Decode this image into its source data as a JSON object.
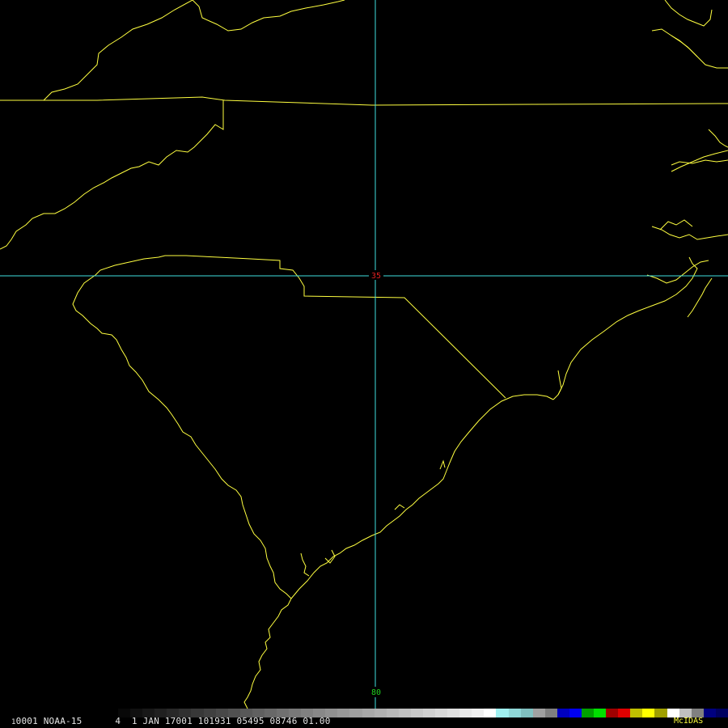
{
  "map": {
    "latitude_label": "35",
    "longitude_label": "80",
    "colors": {
      "background": "#000000",
      "coastline": "#ffff40",
      "gridline": "#40e0e0",
      "latitude_label": "#e02020",
      "longitude_label": "#20d020"
    }
  },
  "status_bar": {
    "frame": "1",
    "line": "0001 NOAA-15      4  1 JAN 17001 101931 05495 08746 01.00",
    "brand": "McIDAS"
  },
  "colorbar": [
    "#080808",
    "#101010",
    "#181818",
    "#202020",
    "#282828",
    "#303030",
    "#383838",
    "#404040",
    "#484848",
    "#505050",
    "#585858",
    "#606060",
    "#686868",
    "#707070",
    "#787878",
    "#808080",
    "#888888",
    "#909090",
    "#989898",
    "#a0a0a0",
    "#a8a8a8",
    "#b0b0b0",
    "#b8b8b8",
    "#c0c0c0",
    "#c8c8c8",
    "#d0d0d0",
    "#d8d8d8",
    "#e0e0e0",
    "#e8e8e8",
    "#f0f0f0",
    "#ffffff",
    "#a0f0f0",
    "#90d8d8",
    "#80c0c0",
    "#a0a0a0",
    "#808080",
    "#0000c0",
    "#0000f0",
    "#00a000",
    "#00e000",
    "#a00000",
    "#e00000",
    "#c0c000",
    "#ffff00",
    "#a0a000",
    "#ffffff",
    "#c0c0c0",
    "#808080",
    "#000080",
    "#000060"
  ]
}
